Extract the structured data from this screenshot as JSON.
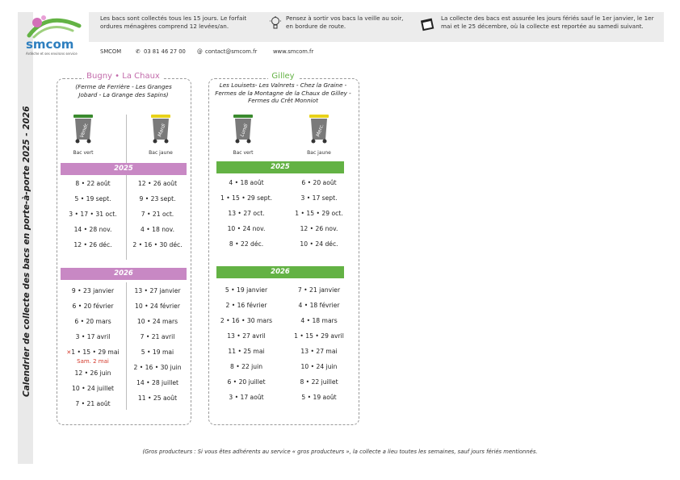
{
  "vertical_title": "Calendrier de collecte des bacs en porte-à-porte 2025 - 2026",
  "logo": {
    "text": "smcom",
    "tagline": "Ardèche et ses environs service"
  },
  "header": {
    "info1": "Les bacs sont collectés tous les 15 jours. Le forfait ordures ménagères comprend 12 levées/an.",
    "info2": "Pensez à sortir vos bacs la veille au soir, en bordure de route.",
    "info3": "La collecte des bacs est assurée les jours fériés sauf le 1er janvier, le 1er mai et le 25 décembre, où la collecte est reportée au samedi suivant."
  },
  "contact": {
    "org": "SMCOM",
    "phone": "03 81 46 27 00",
    "email": "contact@smcom.fr",
    "web": "www.smcom.fr"
  },
  "panel_left": {
    "title_a": "Bugny",
    "title_b": "La Chaux",
    "subtitle": "(Ferme de Ferrière - Les Granges Jobard - La Grange des Sapins)",
    "bin1_day": "Vendr.",
    "bin1_label": "Bac vert",
    "bin2_day": "Mardi",
    "bin2_label": "Bac jaune",
    "y2025": "2025",
    "y2026": "2026",
    "col1_2025": [
      "8 • 22 août",
      "5 • 19 sept.",
      "3 • 17 • 31 oct.",
      "14 • 28 nov.",
      "12 • 26 déc."
    ],
    "col2_2025": [
      "12 • 26 août",
      "9 • 23 sept.",
      "7 • 21 oct.",
      "4 • 18 nov.",
      "2 • 16 • 30 déc."
    ],
    "col1_2026": [
      "9 • 23 janvier",
      "6 • 20 février",
      "6 • 20 mars",
      "3 • 17 avril",
      "1 • 15 • 29 mai",
      "12 • 26 juin",
      "10 • 24 juillet",
      "7 • 21 août"
    ],
    "moved_note": "Sam. 2 mai",
    "col2_2026": [
      "13 • 27 janvier",
      "10 • 24 février",
      "10 • 24 mars",
      "7 • 21 avril",
      "5 • 19 mai",
      "2 • 16 • 30 juin",
      "14 • 28 juillet",
      "11 • 25 août"
    ]
  },
  "panel_right": {
    "title": "Gilley",
    "subtitle": "Les Louisets- Les Valnrets - Chez la Graine - Fermes de la Montagne de la Chaux de Gilley - Fermes du Crêt Monniot",
    "bin1_day": "Lundi",
    "bin1_label": "Bac vert",
    "bin2_day": "Merc.",
    "bin2_label": "Bac jaune",
    "y2025": "2025",
    "y2026": "2026",
    "col1_2025": [
      "4 • 18 août",
      "1 • 15 • 29 sept.",
      "13 • 27 oct.",
      "10 • 24 nov.",
      "8 • 22 déc."
    ],
    "col2_2025": [
      "6 • 20 août",
      "3 • 17 sept.",
      "1 • 15 • 29 oct.",
      "12 • 26 nov.",
      "10 • 24 déc."
    ],
    "col1_2026": [
      "5 • 19 janvier",
      "2 • 16 février",
      "2 • 16 • 30 mars",
      "13 • 27 avril",
      "11 • 25 mai",
      "8 • 22 juin",
      "6 • 20 juillet",
      "3 • 17 août"
    ],
    "col2_2026": [
      "7 • 21 janvier",
      "4 • 18 février",
      "4 • 18 mars",
      "1 • 15 • 29 avril",
      "13 • 27 mai",
      "10 • 24 juin",
      "8 • 22 juillet",
      "5 • 19 août"
    ]
  },
  "footer": "(Gros producteurs : Si vous êtes adhérents au service « gros producteurs », la collecte a lieu toutes les semaines, sauf jours fériés mentionnés.",
  "colors": {
    "pink": "#c888c4",
    "green": "#63b244",
    "bin_green": "#3a8a2e",
    "bin_yellow": "#e8d21a"
  }
}
